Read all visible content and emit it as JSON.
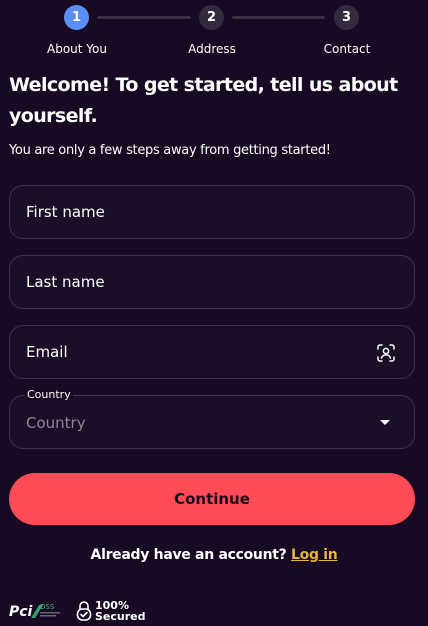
{
  "stepper": {
    "steps": [
      {
        "number": "1",
        "label": "About You",
        "active": true
      },
      {
        "number": "2",
        "label": "Address",
        "active": false
      },
      {
        "number": "3",
        "label": "Contact",
        "active": false
      }
    ]
  },
  "header": {
    "title": "Welcome! To get started, tell us about yourself.",
    "subtitle": "You are only a few steps away from getting started!"
  },
  "form": {
    "first_name_placeholder": "First name",
    "last_name_placeholder": "Last name",
    "email_placeholder": "Email",
    "email_icon": "scan-user-icon",
    "country_caption": "Country",
    "country_value": "Country",
    "country_icon": "chevron-down-icon"
  },
  "actions": {
    "continue_label": "Continue",
    "have_account_text": "Already have an account?",
    "login_label": "Log in"
  },
  "footer": {
    "pci_text": "Pci",
    "dss_text": "DSS",
    "secured_top": "100%",
    "secured_bottom": "Secured"
  },
  "colors": {
    "background": "#170a22",
    "accent": "#ff4b55",
    "active_step": "#5b8ef5",
    "link": "#e6b43f"
  }
}
